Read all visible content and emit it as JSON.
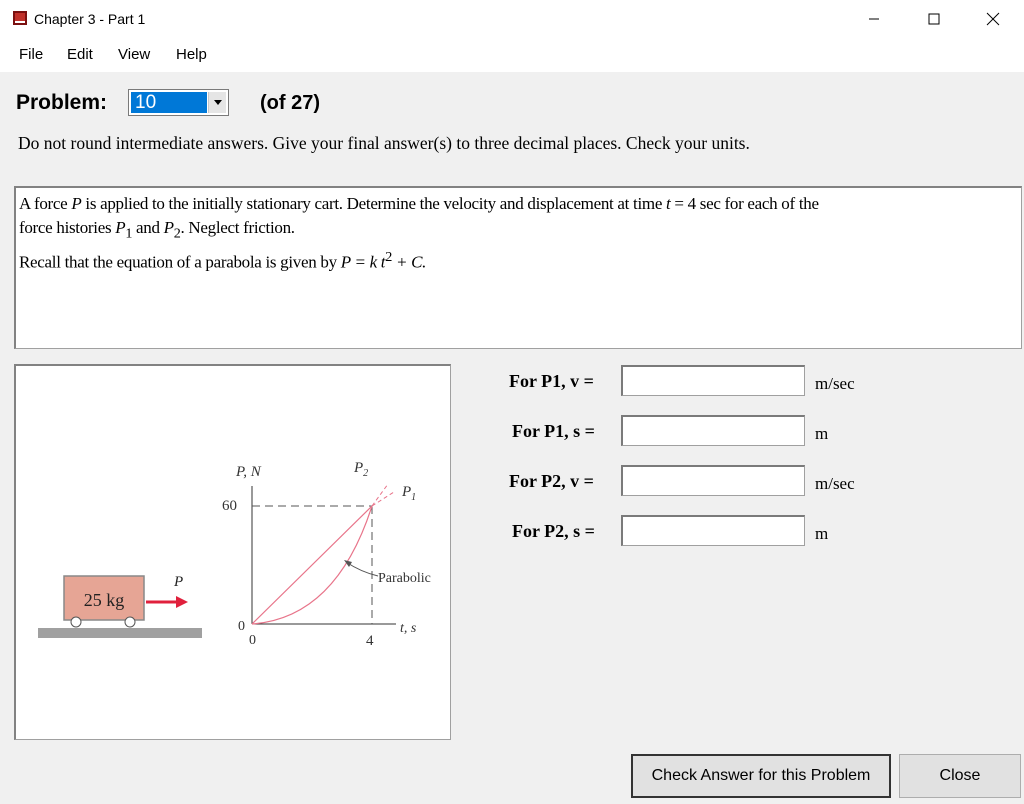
{
  "window": {
    "title": "Chapter 3 - Part 1",
    "minimize_glyph": "—",
    "maximize_glyph": "☐",
    "close_glyph": "✕"
  },
  "menu": {
    "items": [
      "File",
      "Edit",
      "View",
      "Help"
    ]
  },
  "problem": {
    "label": "Problem:",
    "selected": "10",
    "of_label": "(of 27)"
  },
  "instructions": "Do not round intermediate answers.  Give your final answer(s) to three decimal places.  Check your units.",
  "statement": {
    "line1_a": "A force ",
    "line1_P": "P",
    "line1_b": " is applied to the initially stationary cart.  Determine the velocity and displacement at time ",
    "line1_t": "t",
    "line1_c": " = 4 sec for each of the",
    "line2_a": "force histories ",
    "line2_P1": "P",
    "line2_sub1": "1",
    "line2_b": " and ",
    "line2_P2": "P",
    "line2_sub2": "2",
    "line2_c": ". Neglect friction.",
    "line3_a": "Recall that the equation of a parabola is given by ",
    "line3_eq": "P = k t",
    "line3_sup": "2",
    "line3_b": " + C."
  },
  "figure": {
    "mass_label": "25 kg",
    "force_label": "P",
    "y_axis_label": "P, N",
    "y_tick_60": "60",
    "y_tick_0": "0",
    "x_tick_0": "0",
    "x_tick_4": "4",
    "x_axis_label": "t, s",
    "p1_label": "P",
    "p1_sub": "1",
    "p2_label": "P",
    "p2_sub": "2",
    "parabolic_label": "Parabolic",
    "curve_color": "#e8748a",
    "arrow_color": "#e0203c",
    "cart_color": "#e6a595"
  },
  "answers": [
    {
      "label": "For P1, v =",
      "value": "",
      "unit": "m/sec"
    },
    {
      "label": "For P1, s =",
      "value": "",
      "unit": "m"
    },
    {
      "label": "For P2, v =",
      "value": "",
      "unit": "m/sec"
    },
    {
      "label": "For P2, s =",
      "value": "",
      "unit": "m"
    }
  ],
  "buttons": {
    "check": "Check Answer for this Problem",
    "close": "Close"
  }
}
